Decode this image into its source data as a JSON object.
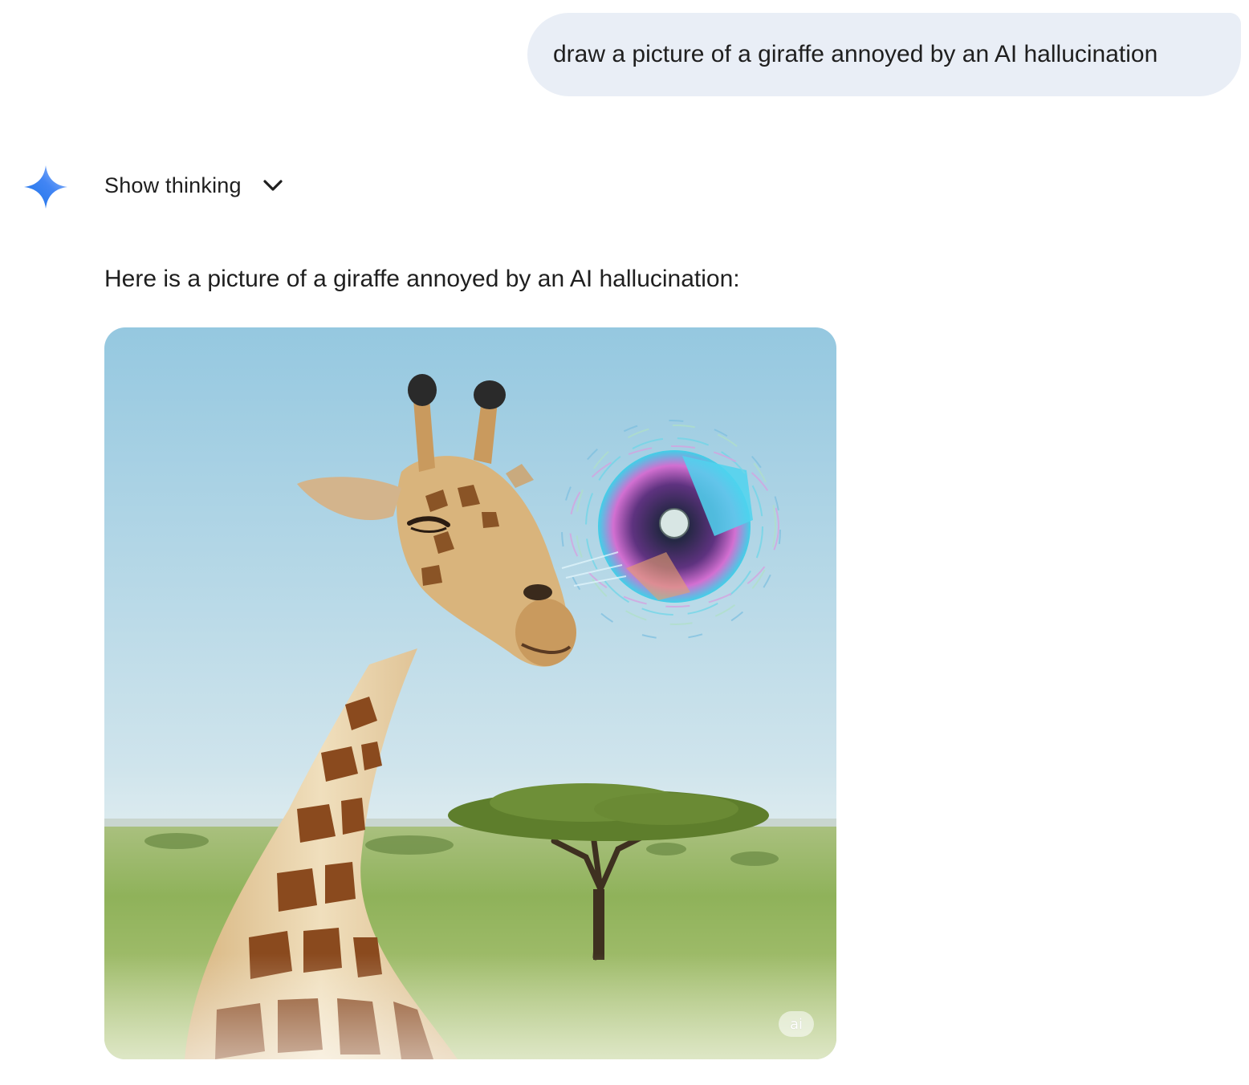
{
  "user_message": {
    "text": "draw a picture of a giraffe annoyed by an AI hallucination"
  },
  "response": {
    "logo_icon": "gemini-sparkle-icon",
    "show_thinking_label": "Show thinking",
    "show_thinking_icon": "chevron-down-icon",
    "text": "Here is a picture of a giraffe annoyed by an AI hallucination:",
    "image": {
      "subject": "giraffe-with-swirling-hallucination-orb",
      "badge_text": "ai"
    }
  },
  "colors": {
    "bubble_background": "#e9eef6",
    "text": "#1f1f1f",
    "sky_top": "#9fcde3",
    "sky_bottom": "#dcebef",
    "grass": "#8fb25a",
    "giraffe_base": "#e9d3a8",
    "giraffe_patch": "#8a4a1e",
    "sparkle_blue": "#4285f4"
  }
}
